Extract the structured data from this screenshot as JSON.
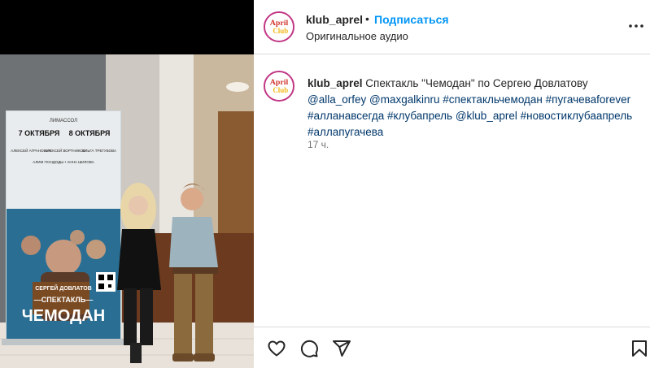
{
  "post": {
    "author": {
      "username": "klub_aprel",
      "avatar_icon": "april-club-logo",
      "avatar_text_1": "April",
      "avatar_text_2": "Club"
    },
    "header": {
      "separator": "•",
      "follow_label": "Подписаться",
      "audio_label": "Оригинальное аудио",
      "more_icon": "more-horizontal-icon"
    },
    "caption": {
      "username": "klub_aprel",
      "text": "Спектакль \"Чемодан\" по Сергею Довлатову",
      "tags": [
        "@alla_orfey",
        "@maxgalkinru",
        "#спектакльчемодан",
        "#пугачеваforever",
        "#алланавсегда",
        "#клубапрель",
        "@klub_aprel",
        "#новостиклубаапрель",
        "#аллапугачева"
      ]
    },
    "timestamp": "17 ч.",
    "actions": {
      "like_icon": "heart-icon",
      "comment_icon": "comment-icon",
      "share_icon": "share-icon",
      "save_icon": "bookmark-icon"
    }
  },
  "poster": {
    "top_brand": "ЛИМАССОЛ",
    "date_1": "7 ОКТЯБРЯ",
    "date_2": "8 ОКТЯБРЯ",
    "cast": [
      "АЛЕКСЕЙ АГРАНОВИЧ",
      "АЛЕКСЕЙ ВОРТНИКОВ",
      "ОЛЬГА ТРЕГУБОВА"
    ],
    "cast_2": "АЛИМ ГЮНДОДЫ • АННА ШИЛОВА",
    "author": "СЕРГЕЙ ДОВЛАТОВ",
    "show_word": "—СПЕКТАКЛЬ—",
    "show_title": "ЧЕМОДАН"
  },
  "colors": {
    "follow": "#0095f6",
    "tag": "#00376b",
    "time": "#737373",
    "border": "#dbdbdb",
    "poster_bg": "#1f6a8e"
  }
}
